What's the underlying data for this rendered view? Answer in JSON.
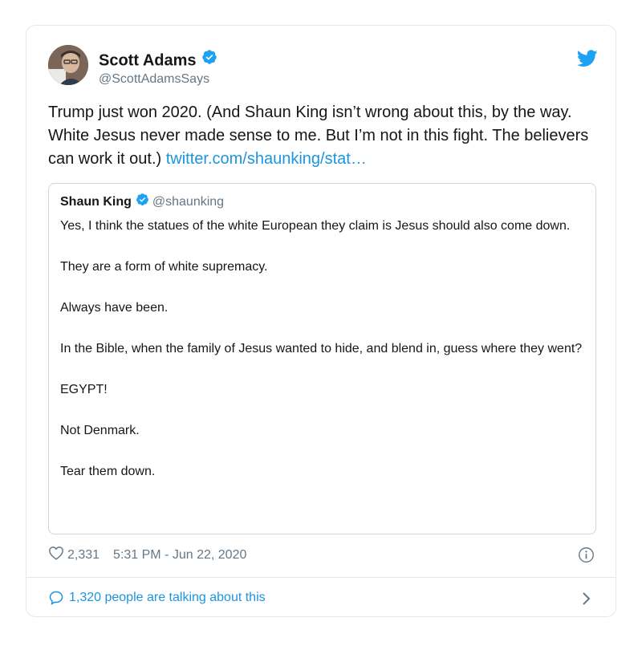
{
  "author": {
    "name": "Scott Adams",
    "handle": "@ScottAdamsSays"
  },
  "tweet": {
    "text": "Trump just won 2020. (And Shaun King isn’t wrong about this, by the way. White Jesus never made sense to me. But I’m not in this fight. The believers can work it out.) ",
    "link": "twitter.com/shaunking/stat…"
  },
  "quoted": {
    "name": "Shaun King",
    "handle": "@shaunking",
    "paragraphs": [
      "Yes, I think the statues of the white European they claim is Jesus should also come down.",
      "They are a form of white supremacy.",
      "Always have been.",
      "In the Bible, when the family of Jesus wanted to hide, and blend in, guess where they went?",
      "EGYPT!",
      "Not Denmark.",
      "Tear them down."
    ]
  },
  "meta": {
    "likes": "2,331",
    "timestamp": "5:31 PM - Jun 22, 2020"
  },
  "conversation": {
    "label": "1,320 people are talking about this"
  },
  "colors": {
    "accent": "#1b95e0",
    "verified": "#1da1f2",
    "muted": "#657786",
    "border": "#e1e8ed"
  }
}
